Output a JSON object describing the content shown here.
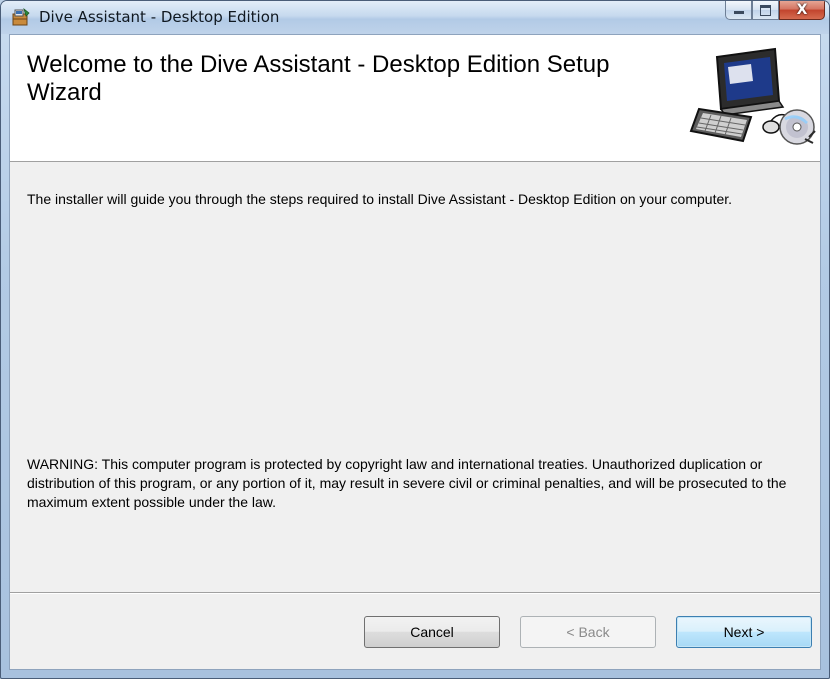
{
  "window": {
    "title": "Dive Assistant - Desktop Edition",
    "caption_buttons": [
      "minimize-icon",
      "maximize-icon",
      "close-icon"
    ],
    "close_glyph": "X"
  },
  "banner": {
    "title": "Welcome to the Dive Assistant - Desktop Edition Setup Wizard",
    "image": "computer-cd-clipart"
  },
  "body": {
    "intro": "The installer will guide you through the steps required to install Dive Assistant - Desktop Edition on your computer.",
    "warning": "WARNING: This computer program is protected by copyright law and international treaties. Unauthorized duplication or distribution of this program, or any portion of it, may result in severe civil or criminal penalties, and will be prosecuted to the maximum extent possible under the law."
  },
  "buttons": {
    "cancel": "Cancel",
    "back": "< Back",
    "next": "Next >"
  },
  "colors": {
    "title_bar": "#c6d9ee",
    "close_button": "#c2442d",
    "default_button_border": "#3c7fb1"
  }
}
